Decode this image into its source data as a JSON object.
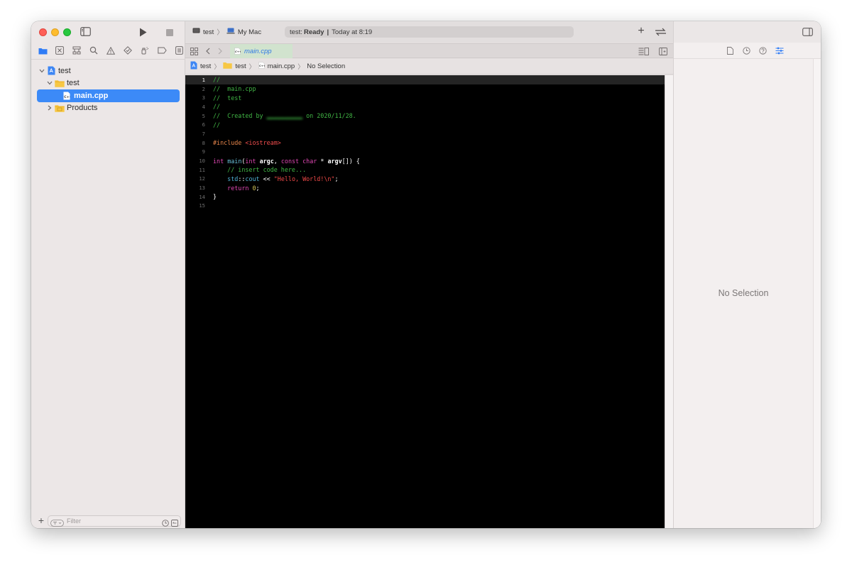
{
  "toolbar": {
    "scheme_target": "test",
    "scheme_device": "My Mac",
    "status_prefix": "test:",
    "status_bold": "Ready",
    "status_sep": "|",
    "status_time": "Today at 8:19"
  },
  "navigator": {
    "tree": [
      {
        "label": "test",
        "kind": "project",
        "expanded": true
      },
      {
        "label": "test",
        "kind": "folder",
        "expanded": true
      },
      {
        "label": "main.cpp",
        "kind": "file",
        "selected": true
      },
      {
        "label": "Products",
        "kind": "folder",
        "expanded": false
      }
    ],
    "filter_placeholder": "Filter"
  },
  "editor": {
    "tab_label": "main.cpp",
    "jumpbar": [
      "test",
      "test",
      "main.cpp",
      "No Selection"
    ],
    "line_numbers": [
      "1",
      "2",
      "3",
      "4",
      "5",
      "6",
      "7",
      "8",
      "9",
      "10",
      "11",
      "12",
      "13",
      "14",
      "15"
    ],
    "current_line": 1
  },
  "inspector": {
    "empty_label": "No Selection"
  },
  "colors": {
    "accent": "#3c8af7",
    "comment": "#41b645",
    "keyword": "#e248b5",
    "string": "#f04a48",
    "preprocessor": "#e6854b"
  }
}
